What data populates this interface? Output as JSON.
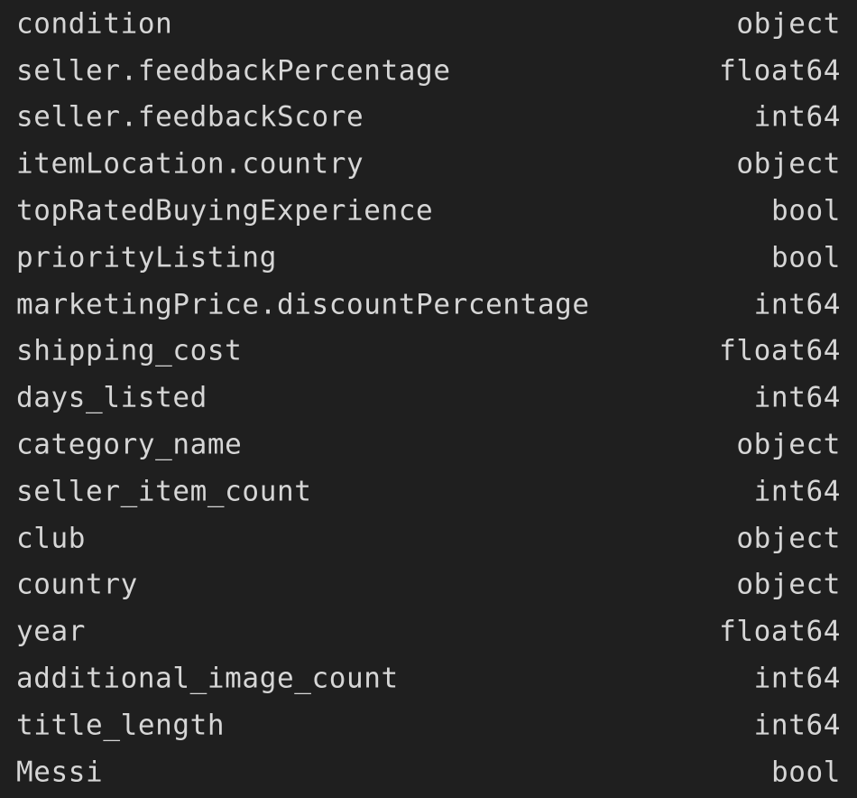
{
  "output": {
    "rows": [
      {
        "name": "condition",
        "dtype": "object"
      },
      {
        "name": "seller.feedbackPercentage",
        "dtype": "float64"
      },
      {
        "name": "seller.feedbackScore",
        "dtype": "int64"
      },
      {
        "name": "itemLocation.country",
        "dtype": "object"
      },
      {
        "name": "topRatedBuyingExperience",
        "dtype": "bool"
      },
      {
        "name": "priorityListing",
        "dtype": "bool"
      },
      {
        "name": "marketingPrice.discountPercentage",
        "dtype": "int64"
      },
      {
        "name": "shipping_cost",
        "dtype": "float64"
      },
      {
        "name": "days_listed",
        "dtype": "int64"
      },
      {
        "name": "category_name",
        "dtype": "object"
      },
      {
        "name": "seller_item_count",
        "dtype": "int64"
      },
      {
        "name": "club",
        "dtype": "object"
      },
      {
        "name": "country",
        "dtype": "object"
      },
      {
        "name": "year",
        "dtype": "float64"
      },
      {
        "name": "additional_image_count",
        "dtype": "int64"
      },
      {
        "name": "title_length",
        "dtype": "int64"
      },
      {
        "name": "Messi",
        "dtype": "bool"
      }
    ]
  },
  "colors": {
    "background": "#1f1f1f",
    "text": "#d6d6d6"
  }
}
